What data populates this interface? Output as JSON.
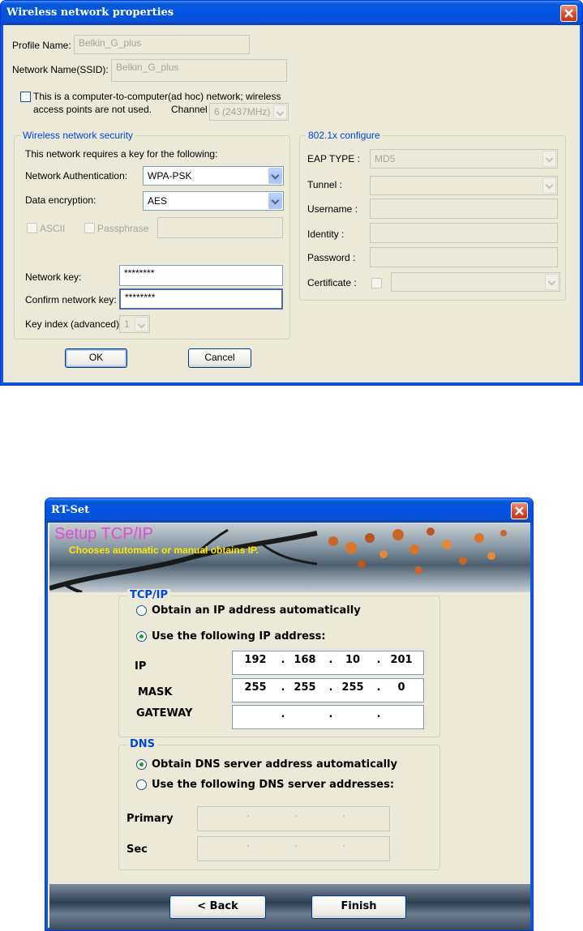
{
  "dialog1": {
    "title": "Wireless network properties",
    "profile_name_label": "Profile Name:",
    "profile_name_value": "Belkin_G_plus",
    "ssid_label": "Network Name(SSID):",
    "ssid_value": "Belkin_G_plus",
    "adhoc_line1": "This is a computer-to-computer(ad hoc) network; wireless",
    "adhoc_line2": "access points are not used.",
    "channel_label": "Channel",
    "channel_value": "6 (2437MHz)",
    "security": {
      "group_title": "Wireless network security",
      "requires_text": "This network requires a key for the following:",
      "auth_label": "Network Authentication:",
      "auth_value": "WPA-PSK",
      "encryption_label": "Data encryption:",
      "encryption_value": "AES",
      "ascii_label": "ASCII",
      "passphrase_label": "Passphrase",
      "network_key_label": "Network key:",
      "network_key_value": "********",
      "confirm_key_label": "Confirm network key:",
      "confirm_key_value": "********",
      "key_index_label": "Key index (advanced):",
      "key_index_value": "1"
    },
    "dot1x": {
      "group_title": "802.1x configure",
      "eap_label": "EAP TYPE :",
      "eap_value": "MD5",
      "tunnel_label": "Tunnel :",
      "username_label": "Username :",
      "identity_label": "Identity :",
      "password_label": "Password :",
      "certificate_label": "Certificate :"
    },
    "ok_label": "OK",
    "cancel_label": "Cancel"
  },
  "dialog2": {
    "title": "RT-Set",
    "banner_title": "Setup TCP/IP",
    "banner_subtitle": "Chooses automatic or manual obtains IP.",
    "tcpip": {
      "group_title": "TCP/IP",
      "auto_label": "Obtain an IP address automatically",
      "manual_label": "Use the following IP address:",
      "ip_label": "IP",
      "ip": [
        "192",
        "168",
        "10",
        "201"
      ],
      "mask_label": "MASK",
      "mask": [
        "255",
        "255",
        "255",
        "0"
      ],
      "gateway_label": "GATEWAY",
      "gateway": [
        "",
        "",
        "",
        ""
      ]
    },
    "dns": {
      "group_title": "DNS",
      "auto_label": "Obtain DNS server address automatically",
      "manual_label": "Use the following DNS server addresses:",
      "primary_label": "Primary",
      "sec_label": "Sec"
    },
    "back_label": "< Back",
    "finish_label": "Finish"
  }
}
